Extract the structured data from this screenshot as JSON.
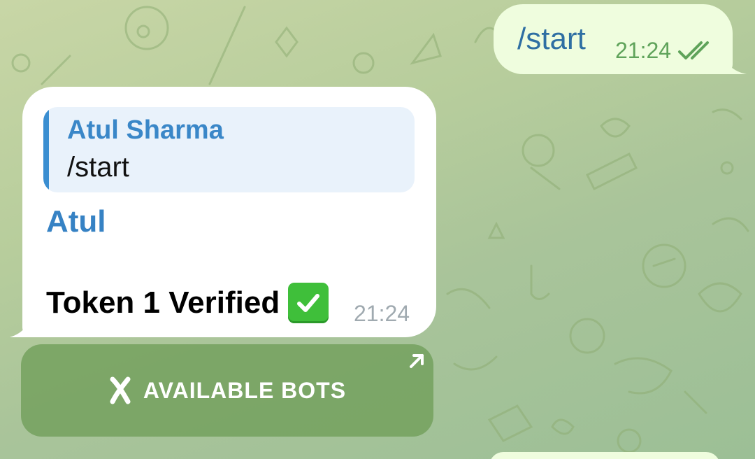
{
  "outgoing": {
    "text": "/start",
    "time": "21:24",
    "status_icon": "double-check-icon"
  },
  "incoming": {
    "reply": {
      "name": "Atul Sharma",
      "text": "/start"
    },
    "sender": "Atul",
    "text": "Token 1 Verified",
    "emoji": "green-check-emoji",
    "time": "21:24"
  },
  "inline_button": {
    "label": "AVAILABLE BOTS",
    "icon": "x-mark-icon",
    "corner_icon": "external-arrow-icon"
  },
  "colors": {
    "outgoing_bubble": "#effdde",
    "incoming_bubble": "#ffffff",
    "accent_blue": "#3682c4",
    "read_green": "#5fa35a",
    "button_green": "#709e58"
  }
}
